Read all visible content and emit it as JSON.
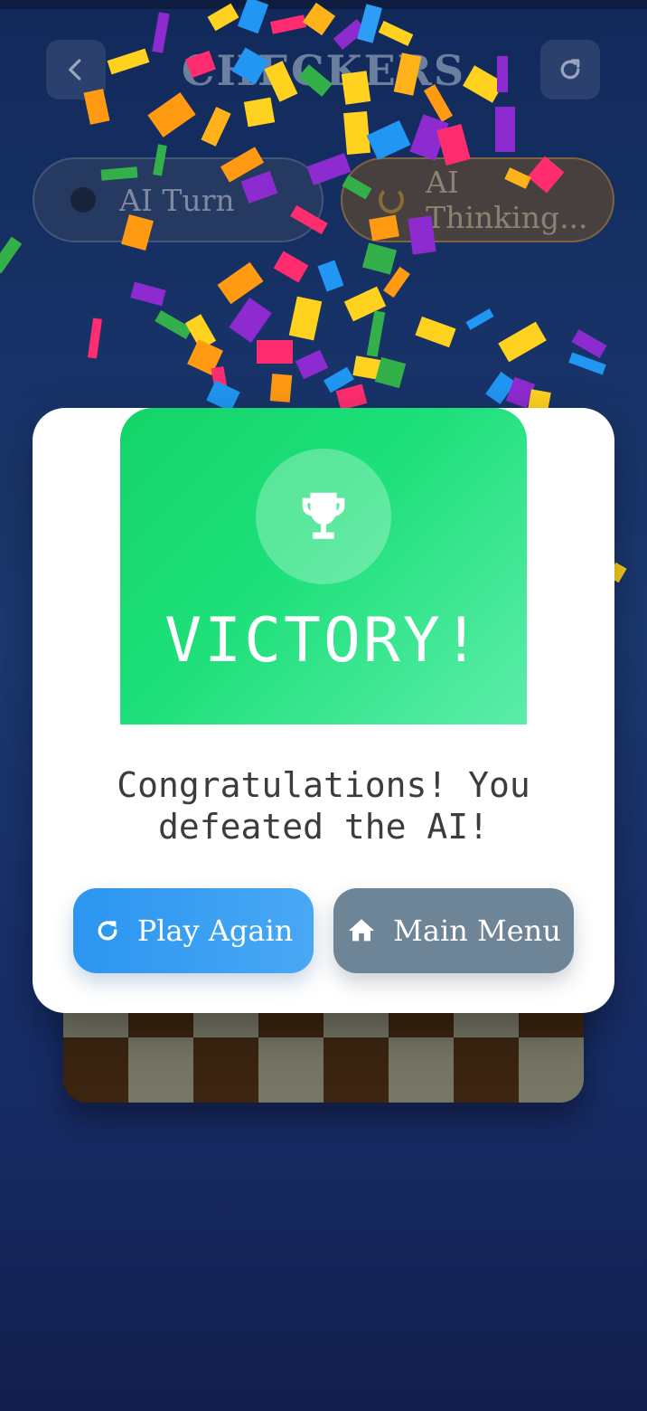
{
  "app": {
    "title": "CHECKERS"
  },
  "status": {
    "turn_label": "AI Turn",
    "thinking_label": "AI Thinking..."
  },
  "dialog": {
    "heading": "VICTORY!",
    "message": "Congratulations! You defeated the AI!",
    "play_again_label": "Play Again",
    "main_menu_label": "Main Menu"
  },
  "icons": {
    "back": "chevron-left-icon",
    "restart": "refresh-icon",
    "trophy": "trophy-icon",
    "home": "home-icon"
  },
  "colors": {
    "victory_green": "#1ee07a",
    "play_again_blue": "#2b95f0",
    "main_menu_gray": "#6d8597"
  }
}
